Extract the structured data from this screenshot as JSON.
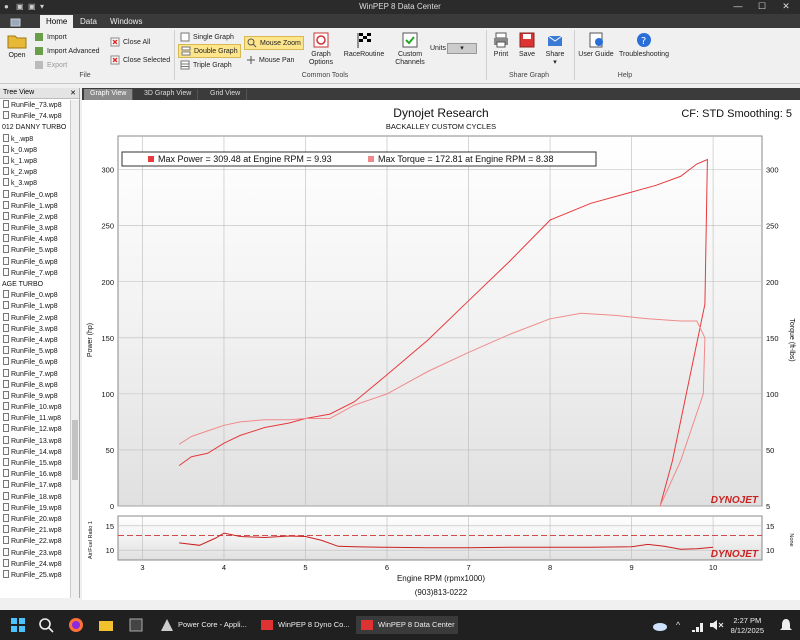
{
  "window": {
    "title": "WinPEP 8 Data Center",
    "controls": {
      "minimize": "—",
      "maximize": "☐",
      "close": "✕"
    }
  },
  "menu": {
    "file": "",
    "tabs": [
      "Home",
      "Data",
      "Windows"
    ]
  },
  "ribbon": {
    "file_group": {
      "open": "Open",
      "import": "Import",
      "import_advanced": "Import Advanced",
      "export": "Export",
      "close_all": "Close All",
      "close_selected": "Close Selected",
      "label": "File"
    },
    "common_tools": {
      "single_graph": "Single Graph",
      "double_graph": "Double Graph",
      "triple_graph": "Triple Graph",
      "mouse_zoom": "Mouse Zoom",
      "mouse_pan": "Mouse Pan",
      "graph_options": "Graph Options",
      "race_routine": "RaceRoutine",
      "custom_channels": "Custom Channels",
      "units": "Units",
      "label": "Common Tools"
    },
    "share_graph": {
      "print": "Print",
      "save": "Save",
      "share": "Share",
      "label": "Share Graph"
    },
    "help": {
      "user_guide": "User Guide",
      "troubleshooting": "Troubleshooting",
      "label": "Help"
    }
  },
  "tree_view": {
    "header": "Tree View",
    "items": [
      "RunFile_73.wp8",
      "RunFile_74.wp8",
      "012 DANNY TURBO",
      "k_.wp8",
      "k_0.wp8",
      "k_1.wp8",
      "k_2.wp8",
      "k_3.wp8",
      "RunFile_0.wp8",
      "RunFile_1.wp8",
      "RunFile_2.wp8",
      "RunFile_3.wp8",
      "RunFile_4.wp8",
      "RunFile_5.wp8",
      "RunFile_6.wp8",
      "RunFile_7.wp8",
      "AGE TURBO",
      "RunFile_0.wp8",
      "RunFile_1.wp8",
      "RunFile_2.wp8",
      "RunFile_3.wp8",
      "RunFile_4.wp8",
      "RunFile_5.wp8",
      "RunFile_6.wp8",
      "RunFile_7.wp8",
      "RunFile_8.wp8",
      "RunFile_9.wp8",
      "RunFile_10.wp8",
      "RunFile_11.wp8",
      "RunFile_12.wp8",
      "RunFile_13.wp8",
      "RunFile_14.wp8",
      "RunFile_15.wp8",
      "RunFile_16.wp8",
      "RunFile_17.wp8",
      "RunFile_18.wp8",
      "RunFile_19.wp8",
      "RunFile_20.wp8",
      "RunFile_21.wp8",
      "RunFile_22.wp8",
      "RunFile_23.wp8",
      "RunFile_24.wp8",
      "RunFile_25.wp8"
    ],
    "groups": [
      2,
      16
    ]
  },
  "doc_tabs": [
    "Graph View",
    "3D Graph View",
    "Grid View"
  ],
  "graph": {
    "title": "Dynojet Research",
    "subtitle": "BACKALLEY CUSTOM CYCLES",
    "cf": "CF: STD Smoothing: 5",
    "legend_power": "Max Power = 309.48 at Engine RPM = 9.93",
    "legend_torque": "Max Torque = 172.81 at Engine RPM = 8.38",
    "xlabel": "Engine RPM (rpmx1000)",
    "footer": "(903)813-0222",
    "ylabel_left": "Power (hp)",
    "ylabel_right": "Torque (ft-lbs)",
    "ylabel_afr": "Air/Fuel Ratio 1",
    "ylabel_afr_right": "None",
    "logo": "DYNOJET",
    "power_color": "#e8393c",
    "torque_color": "#f08a8a"
  },
  "chart_data": {
    "type": "line",
    "xlim": [
      2.7,
      10.6
    ],
    "ylim": [
      0,
      330
    ],
    "x_ticks": [
      "3",
      "4",
      "5",
      "6",
      "7",
      "8",
      "9",
      "10"
    ],
    "y_ticks": [
      "0",
      "50",
      "100",
      "150",
      "200",
      "250",
      "300"
    ],
    "y_ticks_right": [
      "5",
      "50",
      "100",
      "150",
      "200",
      "250",
      "300"
    ],
    "afr_ticks": [
      "10",
      "15"
    ],
    "afr_ticks_right": [
      "10",
      "15"
    ],
    "afr_ylim": [
      8,
      17
    ],
    "series": [
      {
        "name": "Power",
        "color": "#e8393c",
        "x": [
          3.45,
          3.6,
          3.8,
          4.0,
          4.2,
          4.5,
          4.8,
          5.0,
          5.3,
          5.6,
          6.0,
          6.5,
          7.0,
          7.5,
          8.0,
          8.5,
          9.0,
          9.3,
          9.6,
          9.8,
          9.93,
          9.9,
          9.5,
          9.35
        ],
        "y": [
          36,
          44,
          47,
          56,
          63,
          70,
          74,
          78,
          82,
          93,
          117,
          148,
          183,
          218,
          255,
          270,
          280,
          286,
          294,
          305,
          309,
          180,
          40,
          0
        ]
      },
      {
        "name": "Torque",
        "color": "#f08a8a",
        "x": [
          3.45,
          3.6,
          3.8,
          4.0,
          4.2,
          4.5,
          4.8,
          5.0,
          5.3,
          5.6,
          6.0,
          6.5,
          7.0,
          7.5,
          8.0,
          8.38,
          8.8,
          9.2,
          9.6,
          9.8,
          9.9,
          9.88,
          9.6,
          9.35
        ],
        "y": [
          55,
          62,
          67,
          72,
          75,
          77,
          77,
          78,
          78,
          90,
          100,
          120,
          137,
          153,
          167,
          172,
          170,
          167,
          165,
          165,
          150,
          100,
          40,
          0
        ]
      },
      {
        "name": "AFR",
        "color": "#cc2020",
        "x": [
          3.45,
          3.7,
          3.9,
          4.0,
          4.2,
          4.5,
          4.8,
          5.0,
          5.2,
          5.4,
          5.6,
          6.0,
          6.5,
          7.0,
          7.5,
          8.0,
          8.5,
          9.0,
          9.2,
          9.4,
          9.6,
          9.8,
          10.0
        ],
        "y": [
          11.5,
          11.0,
          12.5,
          13.5,
          12.8,
          12.6,
          12.9,
          12.8,
          12.0,
          10.8,
          10.7,
          10.6,
          10.5,
          10.5,
          10.6,
          10.6,
          10.6,
          10.7,
          11.2,
          10.8,
          10.2,
          10.3,
          10.6
        ]
      }
    ],
    "afr_reference": 13.0
  },
  "taskbar": {
    "items": [
      "Power Core - Appli...",
      "WinPEP 8 Dyno Co...",
      "WinPEP 8 Data Center"
    ],
    "time": "2:27 PM",
    "date": "8/12/2025"
  }
}
